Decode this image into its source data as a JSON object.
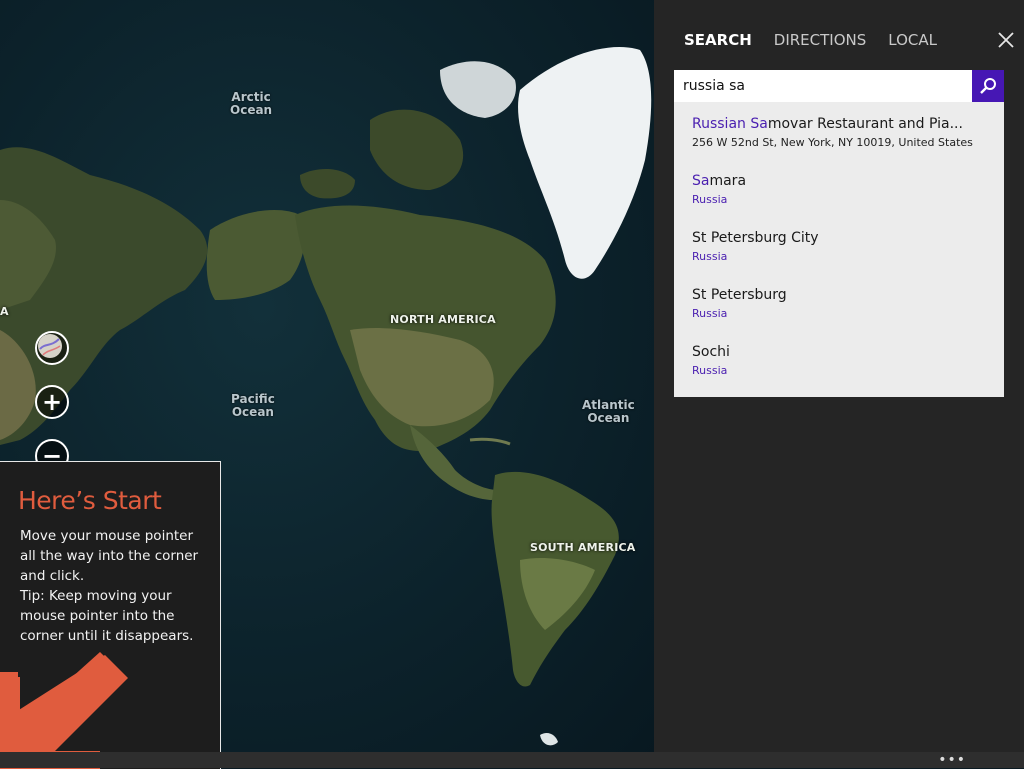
{
  "map": {
    "ocean_labels": {
      "arctic_1": "Arctic",
      "arctic_2": "Ocean",
      "pacific_1": "Pacific",
      "pacific_2": "Ocean",
      "atlantic_1": "Atlantic",
      "atlantic_2": "Ocean"
    },
    "continent_labels": {
      "north_america": "NORTH AMERICA",
      "south_america": "SOUTH AMERICA",
      "edge_letter": "A"
    },
    "controls": {
      "map_style_icon": "map-style-icon",
      "zoom_in_glyph": "+",
      "zoom_out_glyph": "−"
    }
  },
  "start_tip": {
    "title": "Here’s Start",
    "body_lines": [
      "Move your mouse pointer",
      "all the way into the corner",
      "and click.",
      "Tip: Keep moving your",
      "mouse pointer into the",
      "corner until it disappears."
    ],
    "arrow_color": "#e05c3e"
  },
  "search_pane": {
    "tabs": [
      {
        "label": "SEARCH",
        "active": true
      },
      {
        "label": "DIRECTIONS",
        "active": false
      },
      {
        "label": "LOCAL",
        "active": false
      }
    ],
    "close_icon": "close-icon",
    "search_value": "russia sa",
    "search_icon": "search-icon",
    "accent_color": "#4617b4",
    "results": [
      {
        "name_hl": "Russian Sa",
        "name_rest": "movar Restaurant and Pia...",
        "sub": "256 W 52nd St, New York, NY 10019, United States",
        "sub_type": "addr"
      },
      {
        "name_hl": "Sa",
        "name_rest": "mara",
        "sub": "Russia",
        "sub_type": "country"
      },
      {
        "name_hl": "",
        "name_rest": "St Petersburg City",
        "sub": "Russia",
        "sub_type": "country"
      },
      {
        "name_hl": "",
        "name_rest": "St Petersburg",
        "sub": "Russia",
        "sub_type": "country"
      },
      {
        "name_hl": "",
        "name_rest": "Sochi",
        "sub": "Russia",
        "sub_type": "country"
      }
    ]
  },
  "app_bar": {
    "more_label": "•••"
  }
}
